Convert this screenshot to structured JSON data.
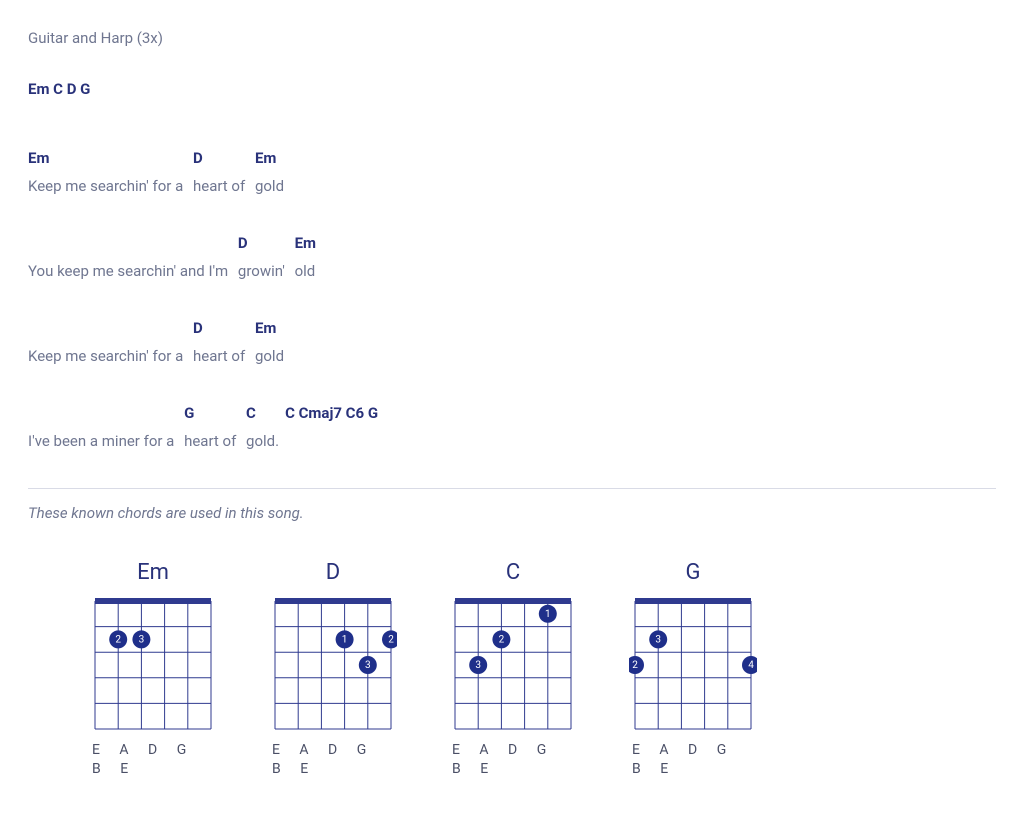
{
  "intro_instruction": "Guitar and Harp (3x)",
  "intro_chords": "Em C D G",
  "lines": [
    [
      {
        "chord": "Em",
        "word": "Keep me searchin' for a "
      },
      {
        "chord": "D",
        "word": "heart of "
      },
      {
        "chord": "Em",
        "word": "gold"
      }
    ],
    [
      {
        "chord": "",
        "word": "You keep me searchin' and I'm "
      },
      {
        "chord": "D",
        "word": "growin' "
      },
      {
        "chord": "Em",
        "word": "old"
      }
    ],
    [
      {
        "chord": "",
        "word": "Keep me searchin' for a "
      },
      {
        "chord": "D",
        "word": "heart of "
      },
      {
        "chord": "Em",
        "word": "gold"
      }
    ],
    [
      {
        "chord": "",
        "word": "I've been a miner for a "
      },
      {
        "chord": "G",
        "word": "heart of "
      },
      {
        "chord": "C",
        "word": "gold."
      },
      {
        "chord": "C Cmaj7 C6 G",
        "word": ""
      }
    ]
  ],
  "known_chords_text": "These known chords are used in this song.",
  "tuning": "E A D G B E",
  "diagrams": [
    {
      "name": "Em",
      "dots": [
        {
          "string": 1,
          "fret": 2,
          "label": "2"
        },
        {
          "string": 2,
          "fret": 2,
          "label": "3"
        }
      ]
    },
    {
      "name": "D",
      "dots": [
        {
          "string": 3,
          "fret": 2,
          "label": "1"
        },
        {
          "string": 5,
          "fret": 2,
          "label": "2"
        },
        {
          "string": 4,
          "fret": 3,
          "label": "3"
        }
      ]
    },
    {
      "name": "C",
      "dots": [
        {
          "string": 4,
          "fret": 1,
          "label": "1"
        },
        {
          "string": 2,
          "fret": 2,
          "label": "2"
        },
        {
          "string": 1,
          "fret": 3,
          "label": "3"
        }
      ]
    },
    {
      "name": "G",
      "dots": [
        {
          "string": 1,
          "fret": 2,
          "label": "3"
        },
        {
          "string": 0,
          "fret": 3,
          "label": "2"
        },
        {
          "string": 5,
          "fret": 3,
          "label": "4"
        }
      ]
    }
  ]
}
